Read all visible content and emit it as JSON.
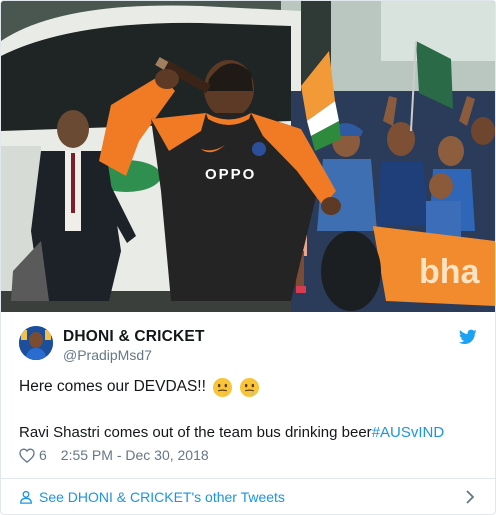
{
  "tweet": {
    "display_name": "DHONI & CRICKET",
    "handle": "@PradipMsd7",
    "line1_text": "Here comes our DEVDAS!!",
    "line1_emojis": [
      "drooling-face-emoji",
      "drooling-face-emoji"
    ],
    "line2_text": "Ravi Shastri comes out of the team bus drinking beer",
    "hashtag": "#AUSvIND",
    "like_count": "6",
    "timestamp": "2:55 PM - Dec 30, 2018"
  },
  "media": {
    "jersey_sponsor": "OPPO",
    "banner_text": "bha"
  },
  "footer": {
    "label": "See DHONI & CRICKET's other Tweets"
  },
  "colors": {
    "link": "#1b95e0",
    "muted": "#657786",
    "border": "#e1e8ed",
    "jersey_orange": "#f07b24"
  },
  "icons": [
    "twitter-bird-icon",
    "heart-icon",
    "person-icon",
    "chevron-right-icon"
  ]
}
